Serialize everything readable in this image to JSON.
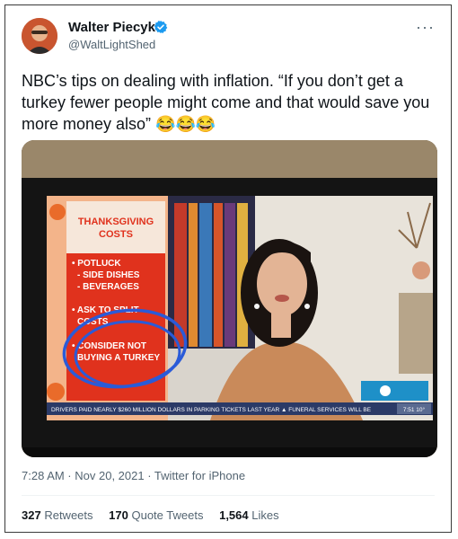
{
  "tweet": {
    "author_name": "Walter Piecyk",
    "author_handle": "@WaltLightShed",
    "more_icon": "more-dots-icon",
    "verified_icon": "verified-badge-icon",
    "text": "NBC’s tips on dealing with inflation. “If you don’t get a turkey fewer people might come and that would save you more money also” 😂😂😂",
    "timestamp": "7:28 AM · Nov 20, 2021 · Twitter for iPhone",
    "stats": [
      {
        "count": "327",
        "label": "Retweets"
      },
      {
        "count": "170",
        "label": "Quote Tweets"
      },
      {
        "count": "1,564",
        "label": "Likes"
      }
    ]
  },
  "tv_graphic": {
    "heading_1": "THANKSGIVING",
    "heading_2": "COSTS",
    "item_1": "• POTLUCK",
    "item_1a": "- SIDE DISHES",
    "item_1b": "- BEVERAGES",
    "item_2a": "• ASK TO SPLIT",
    "item_2b": "COSTS",
    "item_3a": "• CONSIDER NOT",
    "item_3b": "BUYING A TURKEY",
    "ticker": "DRIVERS PAID NEARLY $260 MILLION DOLLARS IN PARKING TICKETS LAST YEAR ▲ FUNERAL SERVICES WILL BE",
    "ticker_time": "7:51 10°"
  },
  "colors": {
    "graphic_red": "#e0321d",
    "annotation_blue": "#2a5bd8",
    "nbc_tile": "#1e90c8"
  }
}
